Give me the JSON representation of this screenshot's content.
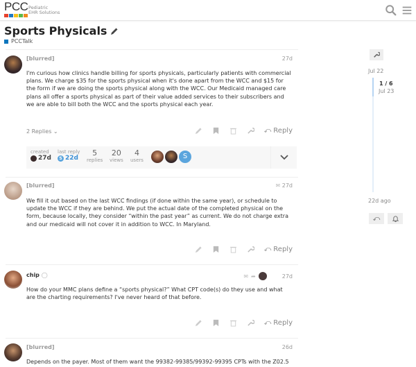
{
  "header": {
    "logo_text": "PCC",
    "logo_sub_line1": "Pediatric",
    "logo_sub_line2": "EHR Solutions",
    "logo_colors": [
      "#e8412c",
      "#1f7ac4",
      "#f6c21b",
      "#5cb947",
      "#f08c1e"
    ],
    "search_icon": "search-icon",
    "menu_icon": "hamburger-menu-icon"
  },
  "topic": {
    "title": "Sports Physicals",
    "edit_icon": "pencil-icon",
    "category": "PCCTalk",
    "category_color": "#0e76bd"
  },
  "posts": [
    {
      "username": "[blurred]",
      "date": "27d",
      "body": "I'm curious how clinics handle billing for sports physicals, particularly patients with commercial plans. We charge $35 for the sports physical when it's done apart from the WCC and $15 for the form if we are doing the sports physical along with the WCC. Our Medicaid managed care plans all offer a sports physical as part of their value added services to their subscribers and we are able to bill both the WCC and the sports physical each year.",
      "replies_toggle": "2 Replies",
      "reply_label": "Reply"
    },
    {
      "username": "[blurred]",
      "date": "27d",
      "body": "We fill it out based on the last WCC findings (if done within the same year), or schedule to update the WCC if they are behind. We put the actual date of the completed physical on the form, because locally, they consider “within the past year” as current. We do not charge extra and our medicaid will not cover it in addition to WCC. In Maryland.",
      "reply_label": "Reply"
    },
    {
      "username": "chip",
      "date": "27d",
      "body": "How do your MMC plans define a “sports physical?” What CPT code(s) do they use and what are the charting requirements? I've never heard of that before.",
      "reply_label": "Reply"
    },
    {
      "username": "[blurred]",
      "date": "26d",
      "body": "Depends on the payer. Most of them want the 99382-99385/99392-99395 CPTs with the Z02.5"
    }
  ],
  "summary": {
    "created_label": "created",
    "created_value": "27d",
    "last_reply_label": "last reply",
    "last_reply_value": "22d",
    "last_reply_avatar_letter": "S",
    "replies_count": "5",
    "replies_label": "replies",
    "views_count": "20",
    "views_label": "views",
    "users_count": "4",
    "users_label": "users",
    "participant_letter": "S"
  },
  "timeline": {
    "start_date": "Jul 22",
    "position": "1 / 6",
    "current_date": "Jul 23",
    "end_label": "22d ago"
  }
}
